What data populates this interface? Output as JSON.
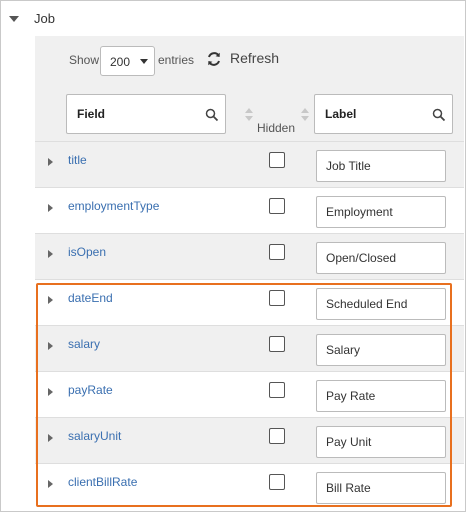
{
  "section": {
    "title": "Job"
  },
  "toolbar": {
    "show_label": "Show",
    "entries_value": "200",
    "entries_label": "entries",
    "refresh_label": "Refresh"
  },
  "table": {
    "headers": {
      "field": "Field",
      "hidden": "Hidden",
      "label": "Label"
    },
    "rows": [
      {
        "field": "title",
        "label": "Job Title",
        "hidden": false
      },
      {
        "field": "employmentType",
        "label": "Employment",
        "hidden": false
      },
      {
        "field": "isOpen",
        "label": "Open/Closed",
        "hidden": false
      },
      {
        "field": "dateEnd",
        "label": "Scheduled End",
        "hidden": false
      },
      {
        "field": "salary",
        "label": "Salary",
        "hidden": false
      },
      {
        "field": "payRate",
        "label": "Pay Rate",
        "hidden": false
      },
      {
        "field": "salaryUnit",
        "label": "Pay Unit",
        "hidden": false
      },
      {
        "field": "clientBillRate",
        "label": "Bill Rate",
        "hidden": false
      }
    ]
  },
  "colors": {
    "highlight": "#e8701f",
    "link": "#3a6fb0",
    "row_alt": "#f0f0f0"
  },
  "icons": [
    "caret-down-icon",
    "refresh-icon",
    "search-icon",
    "sort-icon",
    "caret-right-icon"
  ]
}
